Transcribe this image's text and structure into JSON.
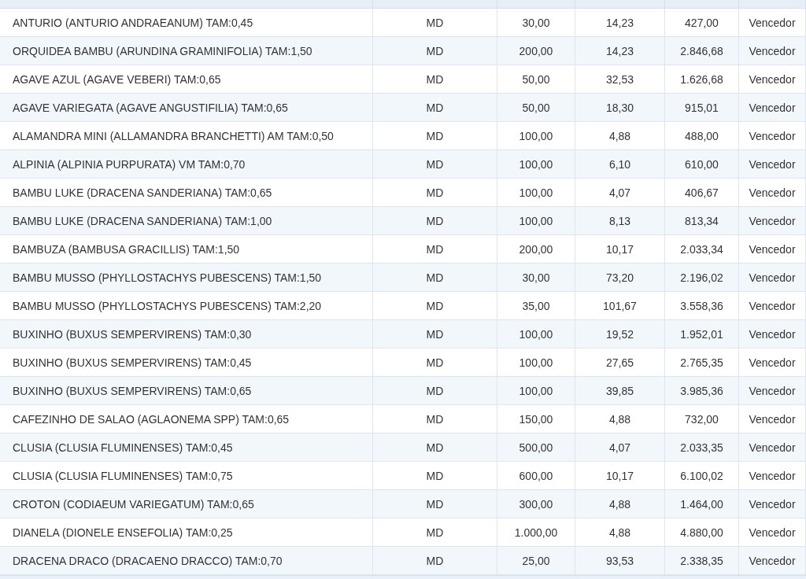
{
  "table": {
    "rows": [
      {
        "cells": [
          "ANTURIO (ANTURIO ANDRAEANUM) TAM:0,45",
          "MD",
          "30,00",
          "14,23",
          "427,00",
          "Vencedor"
        ]
      },
      {
        "cells": [
          "ORQUIDEA BAMBU (ARUNDINA GRAMINIFOLIA) TAM:1,50",
          "MD",
          "200,00",
          "14,23",
          "2.846,68",
          "Vencedor"
        ]
      },
      {
        "cells": [
          "AGAVE AZUL (AGAVE VEBERI) TAM:0,65",
          "MD",
          "50,00",
          "32,53",
          "1.626,68",
          "Vencedor"
        ]
      },
      {
        "cells": [
          "AGAVE VARIEGATA (AGAVE ANGUSTIFILIA) TAM:0,65",
          "MD",
          "50,00",
          "18,30",
          "915,01",
          "Vencedor"
        ]
      },
      {
        "cells": [
          "ALAMANDRA MINI (ALLAMANDRA BRANCHETTI) AM TAM:0,50",
          "MD",
          "100,00",
          "4,88",
          "488,00",
          "Vencedor"
        ]
      },
      {
        "cells": [
          "ALPINIA (ALPINIA PURPURATA) VM TAM:0,70",
          "MD",
          "100,00",
          "6,10",
          "610,00",
          "Vencedor"
        ]
      },
      {
        "cells": [
          "BAMBU LUKE (DRACENA SANDERIANA) TAM:0,65",
          "MD",
          "100,00",
          "4,07",
          "406,67",
          "Vencedor"
        ]
      },
      {
        "cells": [
          "BAMBU LUKE (DRACENA SANDERIANA) TAM:1,00",
          "MD",
          "100,00",
          "8,13",
          "813,34",
          "Vencedor"
        ]
      },
      {
        "cells": [
          "BAMBUZA (BAMBUSA GRACILLIS) TAM:1,50",
          "MD",
          "200,00",
          "10,17",
          "2.033,34",
          "Vencedor"
        ]
      },
      {
        "cells": [
          "BAMBU MUSSO (PHYLLOSTACHYS PUBESCENS) TAM:1,50",
          "MD",
          "30,00",
          "73,20",
          "2.196,02",
          "Vencedor"
        ]
      },
      {
        "cells": [
          "BAMBU MUSSO (PHYLLOSTACHYS PUBESCENS) TAM:2,20",
          "MD",
          "35,00",
          "101,67",
          "3.558,36",
          "Vencedor"
        ]
      },
      {
        "cells": [
          "BUXINHO (BUXUS SEMPERVIRENS) TAM:0,30",
          "MD",
          "100,00",
          "19,52",
          "1.952,01",
          "Vencedor"
        ]
      },
      {
        "cells": [
          "BUXINHO (BUXUS SEMPERVIRENS) TAM:0,45",
          "MD",
          "100,00",
          "27,65",
          "2.765,35",
          "Vencedor"
        ]
      },
      {
        "cells": [
          "BUXINHO (BUXUS SEMPERVIRENS) TAM:0,65",
          "MD",
          "100,00",
          "39,85",
          "3.985,36",
          "Vencedor"
        ]
      },
      {
        "cells": [
          "CAFEZINHO DE SALAO (AGLAONEMA SPP) TAM:0,65",
          "MD",
          "150,00",
          "4,88",
          "732,00",
          "Vencedor"
        ]
      },
      {
        "cells": [
          "CLUSIA (CLUSIA FLUMINENSES) TAM:0,45",
          "MD",
          "500,00",
          "4,07",
          "2.033,35",
          "Vencedor"
        ]
      },
      {
        "cells": [
          "CLUSIA (CLUSIA FLUMINENSES) TAM:0,75",
          "MD",
          "600,00",
          "10,17",
          "6.100,02",
          "Vencedor"
        ]
      },
      {
        "cells": [
          "CROTON (CODIAEUM VARIEGATUM) TAM:0,65",
          "MD",
          "300,00",
          "4,88",
          "1.464,00",
          "Vencedor"
        ]
      },
      {
        "cells": [
          "DIANELA (DIONELE ENSEFOLIA) TAM:0,25",
          "MD",
          "1.000,00",
          "4,88",
          "4.880,00",
          "Vencedor"
        ]
      },
      {
        "cells": [
          "DRACENA DRACO (DRACAENO DRACCO) TAM:0,70",
          "MD",
          "25,00",
          "93,53",
          "2.338,35",
          "Vencedor"
        ]
      }
    ]
  }
}
